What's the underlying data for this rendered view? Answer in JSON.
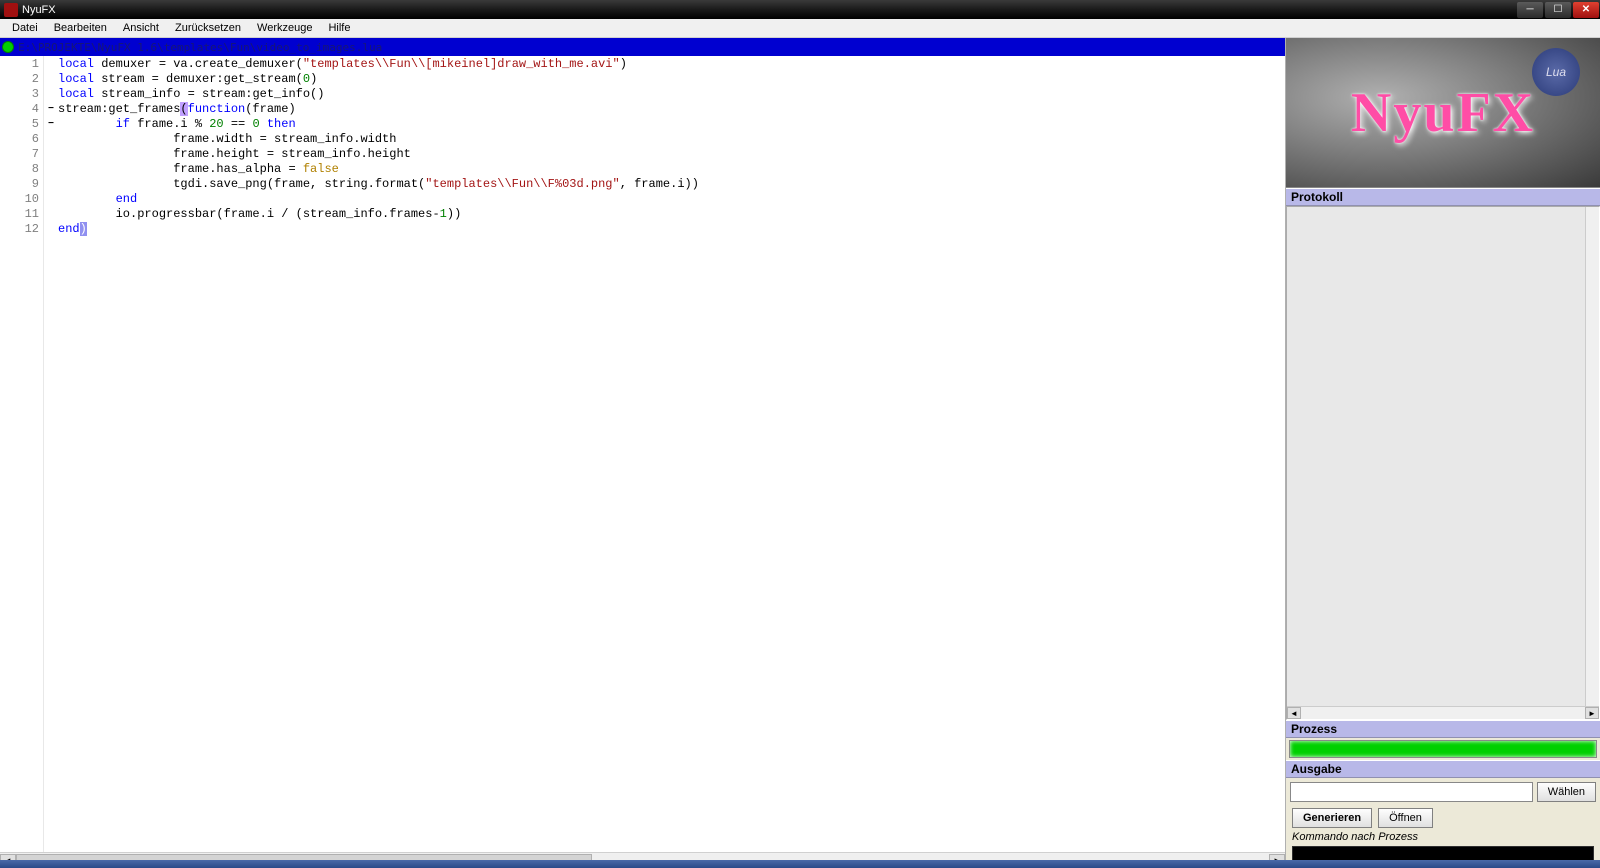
{
  "app": {
    "title": "NyuFX"
  },
  "menu": {
    "file": "Datei",
    "edit": "Bearbeiten",
    "view": "Ansicht",
    "reset": "Zurücksetzen",
    "tools": "Werkzeuge",
    "help": "Hilfe"
  },
  "tab": {
    "path": "E:\\PROJEKTE\\NyuFX 1.6\\templates\\Fun\\video_to_images.lua"
  },
  "logo": {
    "text": "NyuFX",
    "badge": "Lua"
  },
  "panel": {
    "protocol_header": "Protokoll",
    "process_header": "Prozess",
    "output_header": "Ausgabe",
    "choose_button": "Wählen",
    "generate_button": "Generieren",
    "open_button": "Öffnen",
    "command_label": "Kommando nach Prozess",
    "output_value": "",
    "command_value": ""
  },
  "code": {
    "lines": 12,
    "l1": {
      "kw": "local",
      "rest": " demuxer = va.create_demuxer(",
      "str": "\"templates\\\\Fun\\\\[mikeinel]draw_with_me.avi\"",
      "tail": ")"
    },
    "l2": {
      "kw": "local",
      "rest": " stream = demuxer:get_stream(",
      "num": "0",
      "tail": ")"
    },
    "l3": {
      "kw": "local",
      "rest": " stream_info = stream:get_info()"
    },
    "l4": {
      "pre": "stream:get_frames",
      "br_open": "(",
      "kw": "function",
      "rest": "(frame)"
    },
    "l5": {
      "indent": "        ",
      "kw1": "if",
      "mid": " frame.i % ",
      "num1": "20",
      "eq": " == ",
      "num2": "0",
      "sp": " ",
      "kw2": "then"
    },
    "l6": {
      "indent": "                ",
      "txt": "frame.width = stream_info.width"
    },
    "l7": {
      "indent": "                ",
      "txt": "frame.height = stream_info.height"
    },
    "l8": {
      "indent": "                ",
      "pre": "frame.has_alpha = ",
      "val": "false"
    },
    "l9": {
      "indent": "                ",
      "pre": "tgdi.save_png(frame, string.format(",
      "str": "\"templates\\\\Fun\\\\F%03d.png\"",
      "tail": ", frame.i))"
    },
    "l10": {
      "indent": "        ",
      "kw": "end"
    },
    "l11": {
      "indent": "        ",
      "pre": "io.progressbar(frame.i / (stream_info.frames-",
      "num": "1",
      "tail": "))"
    },
    "l12": {
      "kw": "end",
      "br_close": ")"
    }
  }
}
